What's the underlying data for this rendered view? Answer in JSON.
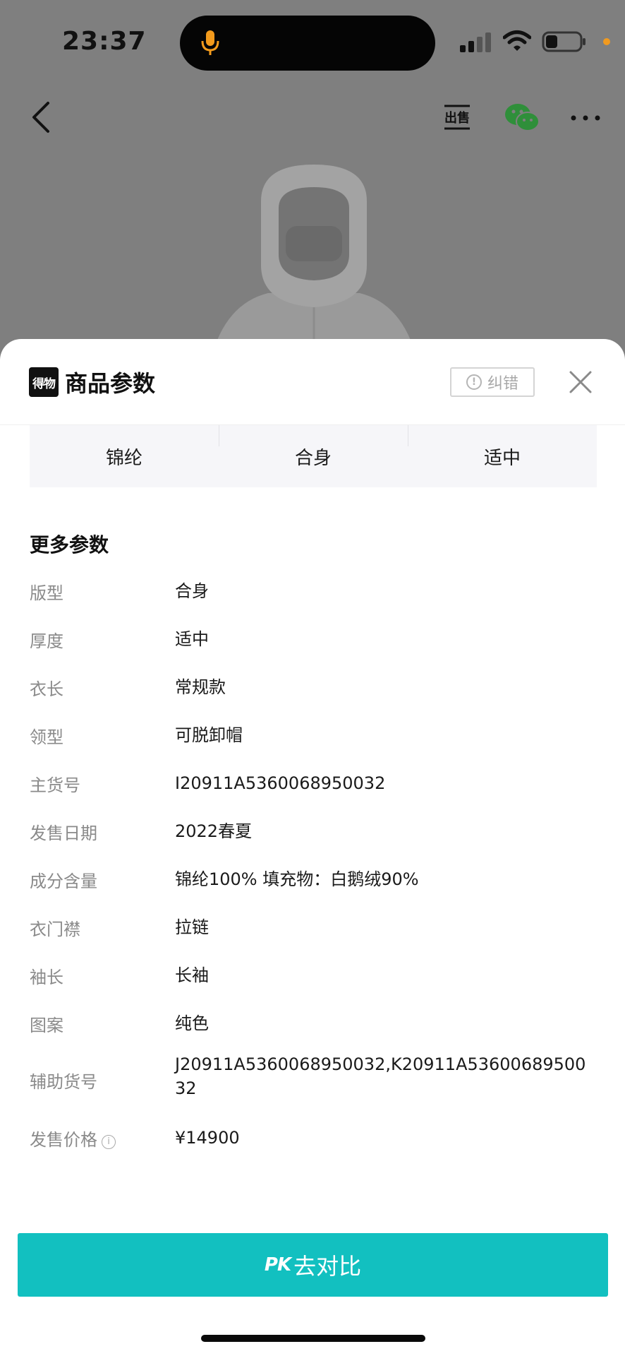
{
  "status_bar": {
    "time": "23:37"
  },
  "icons": {
    "back": "chevron-left-icon",
    "sell": "sell-icon",
    "wechat": "wechat-icon",
    "more": "more-dots-icon",
    "close": "close-icon"
  },
  "sheet": {
    "brand_logo_text": "得物",
    "title": "商品参数",
    "report_label": "纠错",
    "summary": [
      "锦纶",
      "合身",
      "适中"
    ],
    "section_title": "更多参数",
    "params": [
      {
        "label": "版型",
        "value": "合身"
      },
      {
        "label": "厚度",
        "value": "适中"
      },
      {
        "label": "衣长",
        "value": "常规款"
      },
      {
        "label": "领型",
        "value": "可脱卸帽"
      },
      {
        "label": "主货号",
        "value": "I20911A5360068950032"
      },
      {
        "label": "发售日期",
        "value": "2022春夏"
      },
      {
        "label": "成分含量",
        "value": "锦纶100% 填充物：白鹅绒90%"
      },
      {
        "label": "衣门襟",
        "value": "拉链"
      },
      {
        "label": "袖长",
        "value": "长袖"
      },
      {
        "label": "图案",
        "value": "纯色"
      },
      {
        "label": "辅助货号",
        "value": "J20911A5360068950032,K20911A5360068950032"
      },
      {
        "label": "发售价格",
        "value": "¥14900"
      }
    ],
    "pk_mark": "PK",
    "pk_label": "去对比"
  },
  "colors": {
    "accent": "#12c0c0",
    "overlay": "#7f7f7f"
  }
}
